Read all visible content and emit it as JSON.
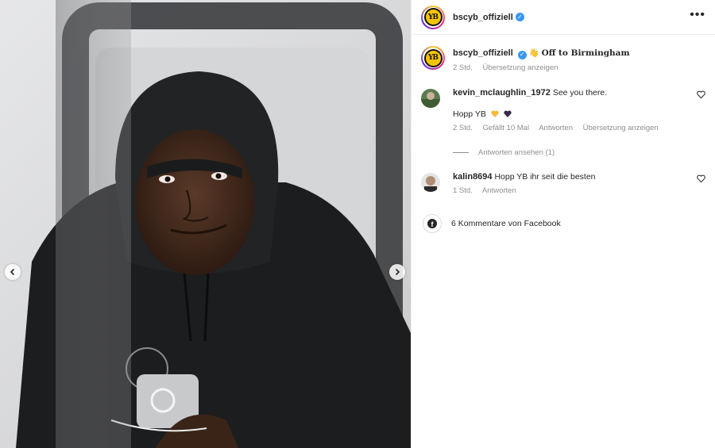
{
  "post": {
    "username": "bscyb_offiziell",
    "logo_text": "YB",
    "caption_emoji": "👋",
    "caption_text": "Off to Birmingham",
    "time": "2 Std.",
    "translate": "Übersetzung anzeigen"
  },
  "header": {
    "username": "bscyb_offiziell",
    "more_icon": "•••"
  },
  "comments": [
    {
      "username": "kevin_mclaughlin_1972",
      "text": "See you there.",
      "text2": "Hopp YB",
      "time": "2 Std.",
      "likes": "Gefällt 10 Mal",
      "reply": "Antworten",
      "translate": "Übersetzung anzeigen",
      "view_replies": "Antworten ansehen (1)"
    },
    {
      "username": "kalin8694",
      "text": "Hopp YB ihr seit die besten",
      "time": "1 Std.",
      "reply": "Antworten"
    }
  ],
  "facebook": {
    "label": "6 Kommentare von Facebook",
    "icon": "f"
  },
  "colors": {
    "verified": "#3897f0",
    "logo_yellow": "#f6c400",
    "meta_gray": "#8e8e8e"
  },
  "icons": {
    "prev": "chevron-left-icon",
    "next": "chevron-right-icon",
    "heart": "heart-icon",
    "verified": "verified-badge-icon",
    "facebook": "facebook-icon"
  }
}
